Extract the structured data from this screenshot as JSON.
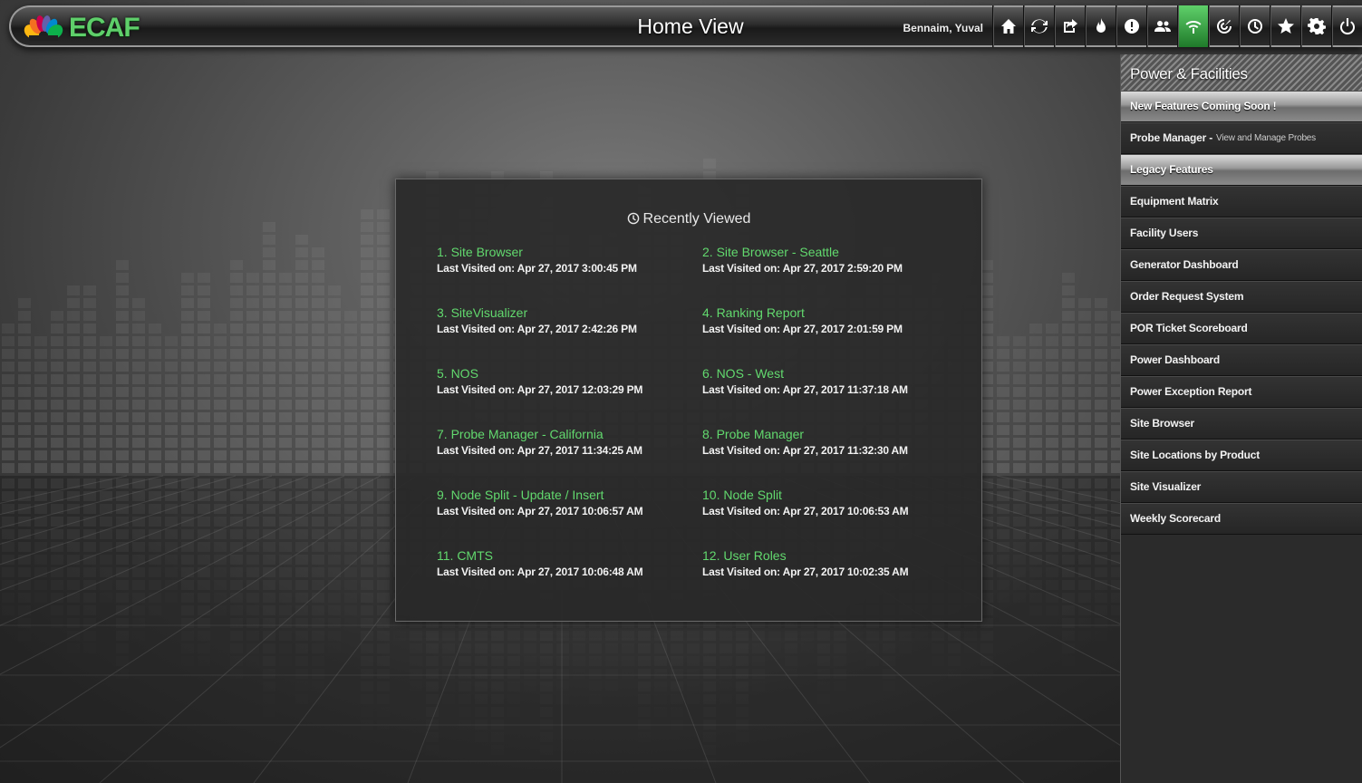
{
  "app": {
    "logo_text": "ECAF",
    "page_title": "Home View",
    "user_name": "Bennaim, Yuval"
  },
  "toolbar": {
    "icons": [
      "home-icon",
      "refresh-icon",
      "share-icon",
      "fire-icon",
      "info-icon",
      "users-icon",
      "wifi-icon",
      "radar-icon",
      "clock-icon",
      "star-icon",
      "gear-icon",
      "power-icon"
    ],
    "active": "wifi-icon",
    "active_color": "#3db34a"
  },
  "recent": {
    "title": "Recently Viewed",
    "items": [
      {
        "label": "1. Site Browser",
        "visited": "Last Visited on: Apr 27, 2017 3:00:45 PM"
      },
      {
        "label": "2. Site Browser - Seattle",
        "visited": "Last Visited on: Apr 27, 2017 2:59:20 PM"
      },
      {
        "label": "3. SiteVisualizer",
        "visited": "Last Visited on: Apr 27, 2017 2:42:26 PM"
      },
      {
        "label": "4. Ranking Report",
        "visited": "Last Visited on: Apr 27, 2017 2:01:59 PM"
      },
      {
        "label": "5. NOS",
        "visited": "Last Visited on: Apr 27, 2017 12:03:29 PM"
      },
      {
        "label": "6. NOS - West",
        "visited": "Last Visited on: Apr 27, 2017 11:37:18 AM"
      },
      {
        "label": "7. Probe Manager - California",
        "visited": "Last Visited on: Apr 27, 2017 11:34:25 AM"
      },
      {
        "label": "8. Probe Manager",
        "visited": "Last Visited on: Apr 27, 2017 11:32:30 AM"
      },
      {
        "label": "9. Node Split - Update / Insert",
        "visited": "Last Visited on: Apr 27, 2017 10:06:57 AM"
      },
      {
        "label": "10. Node Split",
        "visited": "Last Visited on: Apr 27, 2017 10:06:53 AM"
      },
      {
        "label": "11. CMTS",
        "visited": "Last Visited on: Apr 27, 2017 10:06:48 AM"
      },
      {
        "label": "12. User Roles",
        "visited": "Last Visited on: Apr 27, 2017 10:02:35 AM"
      }
    ]
  },
  "sidebar": {
    "title": "Power & Facilities",
    "items": [
      {
        "label": "New Features Coming Soon !",
        "section": true
      },
      {
        "label": "Probe Manager -",
        "sub": "View and Manage Probes"
      },
      {
        "label": "Legacy Features",
        "section": true
      },
      {
        "label": "Equipment Matrix"
      },
      {
        "label": "Facility Users"
      },
      {
        "label": "Generator Dashboard"
      },
      {
        "label": "Order Request System"
      },
      {
        "label": "POR Ticket Scoreboard"
      },
      {
        "label": "Power Dashboard"
      },
      {
        "label": "Power Exception Report"
      },
      {
        "label": "Site Browser"
      },
      {
        "label": "Site Locations by Product"
      },
      {
        "label": "Site Visualizer"
      },
      {
        "label": "Weekly Scorecard"
      }
    ]
  },
  "colors": {
    "link_green": "#62d96e",
    "logo_green": "#5ecf6a"
  }
}
